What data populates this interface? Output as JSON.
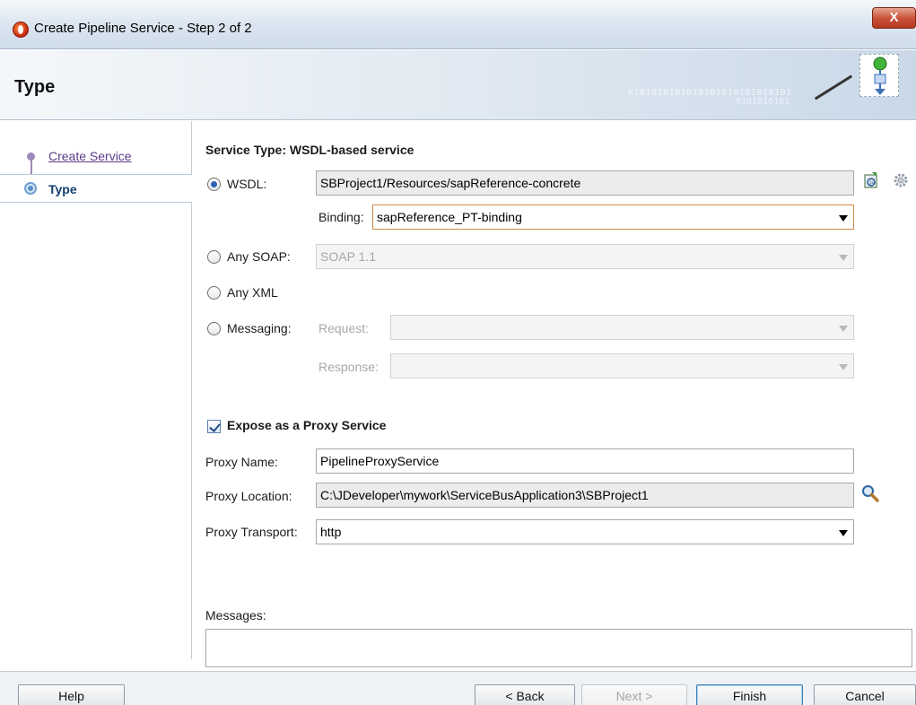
{
  "window": {
    "title": "Create Pipeline Service - Step 2 of 2",
    "close_label": "X"
  },
  "header": {
    "title": "Type",
    "binary_text": "0101010101010101010101010101",
    "binary_text_2": "0101010101"
  },
  "nav": {
    "items": [
      {
        "label": "Create Service",
        "state": "visited"
      },
      {
        "label": "Type",
        "state": "current"
      }
    ]
  },
  "form": {
    "section_title": "Service Type: WSDL-based service",
    "wsdl": {
      "label": "WSDL:",
      "selected": true,
      "value": "SBProject1/Resources/sapReference-concrete",
      "binding_label": "Binding:",
      "binding_value": "sapReference_PT-binding"
    },
    "any_soap": {
      "label": "Any SOAP:",
      "selected": false,
      "value": "SOAP 1.1"
    },
    "any_xml": {
      "label": "Any XML",
      "selected": false
    },
    "messaging": {
      "label": "Messaging:",
      "selected": false,
      "request_label": "Request:",
      "request_value": "",
      "response_label": "Response:",
      "response_value": ""
    },
    "proxy": {
      "expose_label": "Expose as a Proxy Service",
      "expose_checked": true,
      "name_label": "Proxy Name:",
      "name_value": "PipelineProxyService",
      "location_label": "Proxy Location:",
      "location_value": "C:\\JDeveloper\\mywork\\ServiceBusApplication3\\SBProject1",
      "transport_label": "Proxy Transport:",
      "transport_value": "http"
    },
    "messages_label": "Messages:",
    "messages_value": ""
  },
  "footer": {
    "help": "Help",
    "back": "< Back",
    "next": "Next >",
    "finish": "Finish",
    "cancel": "Cancel"
  }
}
